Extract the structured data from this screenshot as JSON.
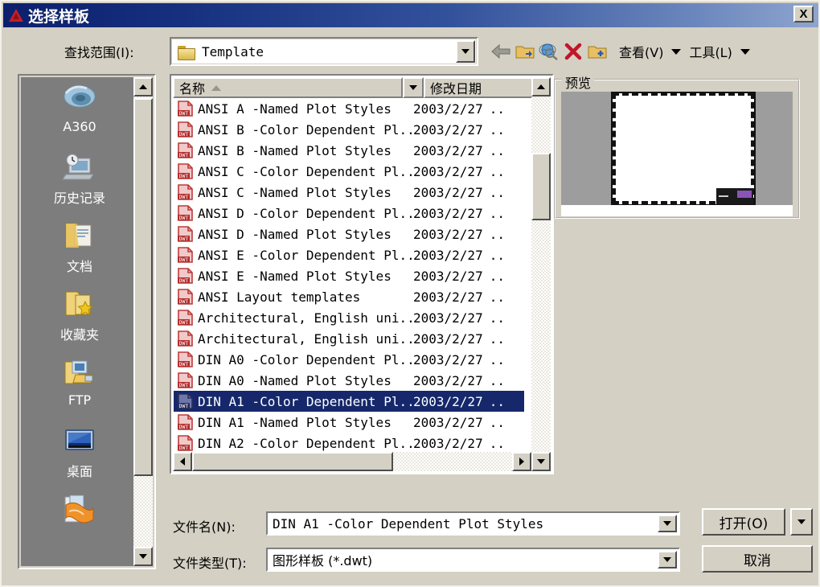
{
  "window": {
    "title": "选择样板",
    "app_icon": "autocad-logo-icon",
    "close_label": "X"
  },
  "toolbar": {
    "lookin_label": "查找范围(I):",
    "lookin_value": "Template",
    "back_icon": "back-arrow-icon",
    "up_icon": "up-one-level-folder-icon",
    "search_icon": "search-web-icon",
    "delete_icon": "delete-x-icon",
    "newfolder_icon": "new-folder-icon",
    "view_label": "查看(V)",
    "tools_label": "工具(L)"
  },
  "places": {
    "items": [
      {
        "label": "A360",
        "icon": "a360-cloud-icon"
      },
      {
        "label": "历史记录",
        "icon": "history-icon"
      },
      {
        "label": "文档",
        "icon": "documents-folder-icon"
      },
      {
        "label": "收藏夹",
        "icon": "favorites-folder-icon"
      },
      {
        "label": "FTP",
        "icon": "ftp-folder-icon"
      },
      {
        "label": "桌面",
        "icon": "desktop-icon"
      },
      {
        "label": "",
        "icon": "buzzsaw-folder-icon"
      }
    ]
  },
  "filelist": {
    "columns": [
      "名称",
      "修改日期"
    ],
    "sort_column": "名称",
    "sort_direction": "asc",
    "date_suffix": "..",
    "rows": [
      {
        "name": "ANSI A -Named Plot Styles",
        "date": "2003/2/27",
        "selected": false
      },
      {
        "name": "ANSI B -Color Dependent Pl...",
        "date": "2003/2/27",
        "selected": false
      },
      {
        "name": "ANSI B -Named Plot Styles",
        "date": "2003/2/27",
        "selected": false
      },
      {
        "name": "ANSI C -Color Dependent Pl...",
        "date": "2003/2/27",
        "selected": false
      },
      {
        "name": "ANSI C -Named Plot Styles",
        "date": "2003/2/27",
        "selected": false
      },
      {
        "name": "ANSI D -Color Dependent Pl...",
        "date": "2003/2/27",
        "selected": false
      },
      {
        "name": "ANSI D -Named Plot Styles",
        "date": "2003/2/27",
        "selected": false
      },
      {
        "name": "ANSI E -Color Dependent Pl...",
        "date": "2003/2/27",
        "selected": false
      },
      {
        "name": "ANSI E -Named Plot Styles",
        "date": "2003/2/27",
        "selected": false
      },
      {
        "name": "ANSI Layout templates",
        "date": "2003/2/27",
        "selected": false
      },
      {
        "name": "Architectural, English uni...",
        "date": "2003/2/27",
        "selected": false
      },
      {
        "name": "Architectural, English uni...",
        "date": "2003/2/27",
        "selected": false
      },
      {
        "name": "DIN A0 -Color Dependent Pl...",
        "date": "2003/2/27",
        "selected": false
      },
      {
        "name": "DIN A0 -Named Plot Styles",
        "date": "2003/2/27",
        "selected": false
      },
      {
        "name": "DIN A1 -Color Dependent Pl...",
        "date": "2003/2/27",
        "selected": true
      },
      {
        "name": "DIN A1 -Named Plot Styles",
        "date": "2003/2/27",
        "selected": false
      },
      {
        "name": "DIN A2 -Color Dependent Pl...",
        "date": "2003/2/27",
        "selected": false
      }
    ]
  },
  "preview": {
    "legend": "预览"
  },
  "bottom": {
    "filename_label": "文件名(N):",
    "filename_value": "DIN A1 -Color Dependent Plot Styles",
    "filetype_label": "文件类型(T):",
    "filetype_value": "图形样板 (*.dwt)",
    "open_label": "打开(O)",
    "cancel_label": "取消"
  },
  "colors": {
    "titlebar_start": "#0b1f6e",
    "titlebar_end": "#8ea5ce",
    "dialog_face": "#d4d0c4",
    "selection": "#16286b",
    "places_bg": "#7d7d7d"
  }
}
